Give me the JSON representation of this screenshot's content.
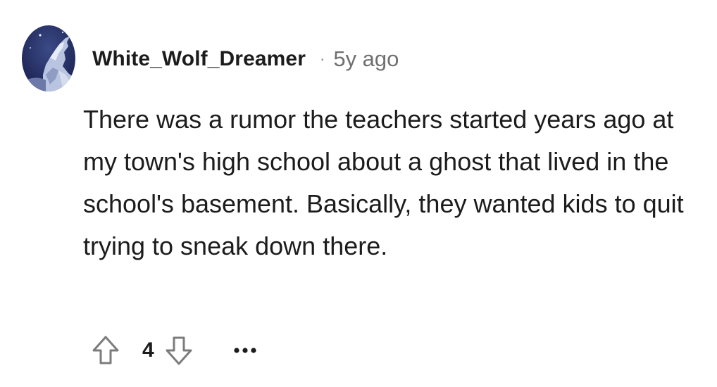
{
  "comment": {
    "author": "White_Wolf_Dreamer",
    "separator": "·",
    "age": "5y ago",
    "body": "There was a rumor the teachers started years ago at my town's high school about a ghost that lived in the school's basement. Basically, they wanted kids to quit trying to sneak down there.",
    "score": "4",
    "avatar_icon": "wolf-howling-avatar",
    "upvote_icon": "upvote-arrow-icon",
    "downvote_icon": "downvote-arrow-icon",
    "more_icon": "more-options-icon",
    "more_label": "•••"
  },
  "colors": {
    "text": "#1c1c1c",
    "meta": "#6f6f6f",
    "icon": "#7c7c7c",
    "background": "#ffffff"
  }
}
